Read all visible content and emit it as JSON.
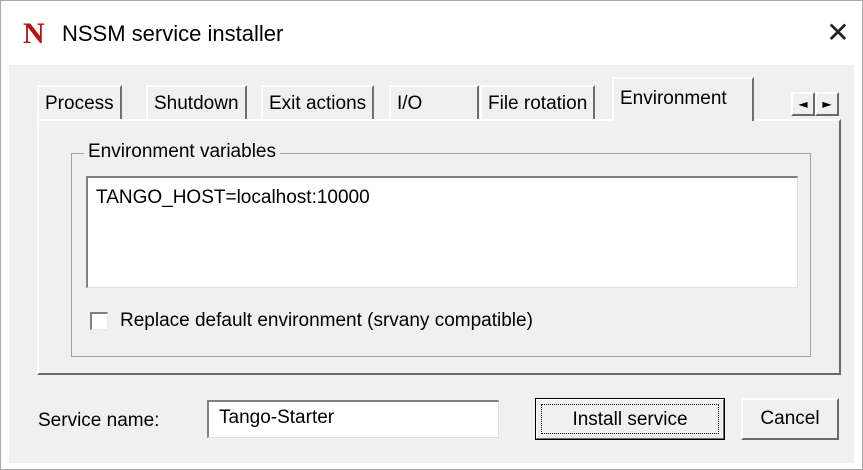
{
  "window": {
    "title": "NSSM service installer",
    "icon_letter": "N",
    "close_glyph": "✕"
  },
  "tabs": [
    {
      "label": "Process"
    },
    {
      "label": "Shutdown"
    },
    {
      "label": "Exit actions"
    },
    {
      "label": "I/O"
    },
    {
      "label": "File rotation"
    },
    {
      "label": "Environment",
      "active": true
    }
  ],
  "tab_scroll": {
    "left": "◄",
    "right": "►"
  },
  "environment": {
    "group_label": "Environment variables",
    "value": "TANGO_HOST=localhost:10000",
    "replace_default_label": "Replace default environment (srvany compatible)",
    "replace_default_checked": false
  },
  "footer": {
    "service_name_label": "Service name:",
    "service_name_value": "Tango-Starter",
    "install_label": "Install service",
    "cancel_label": "Cancel"
  },
  "colors": {
    "icon": "#b01515",
    "dialog_bg": "#f0f0f0"
  }
}
